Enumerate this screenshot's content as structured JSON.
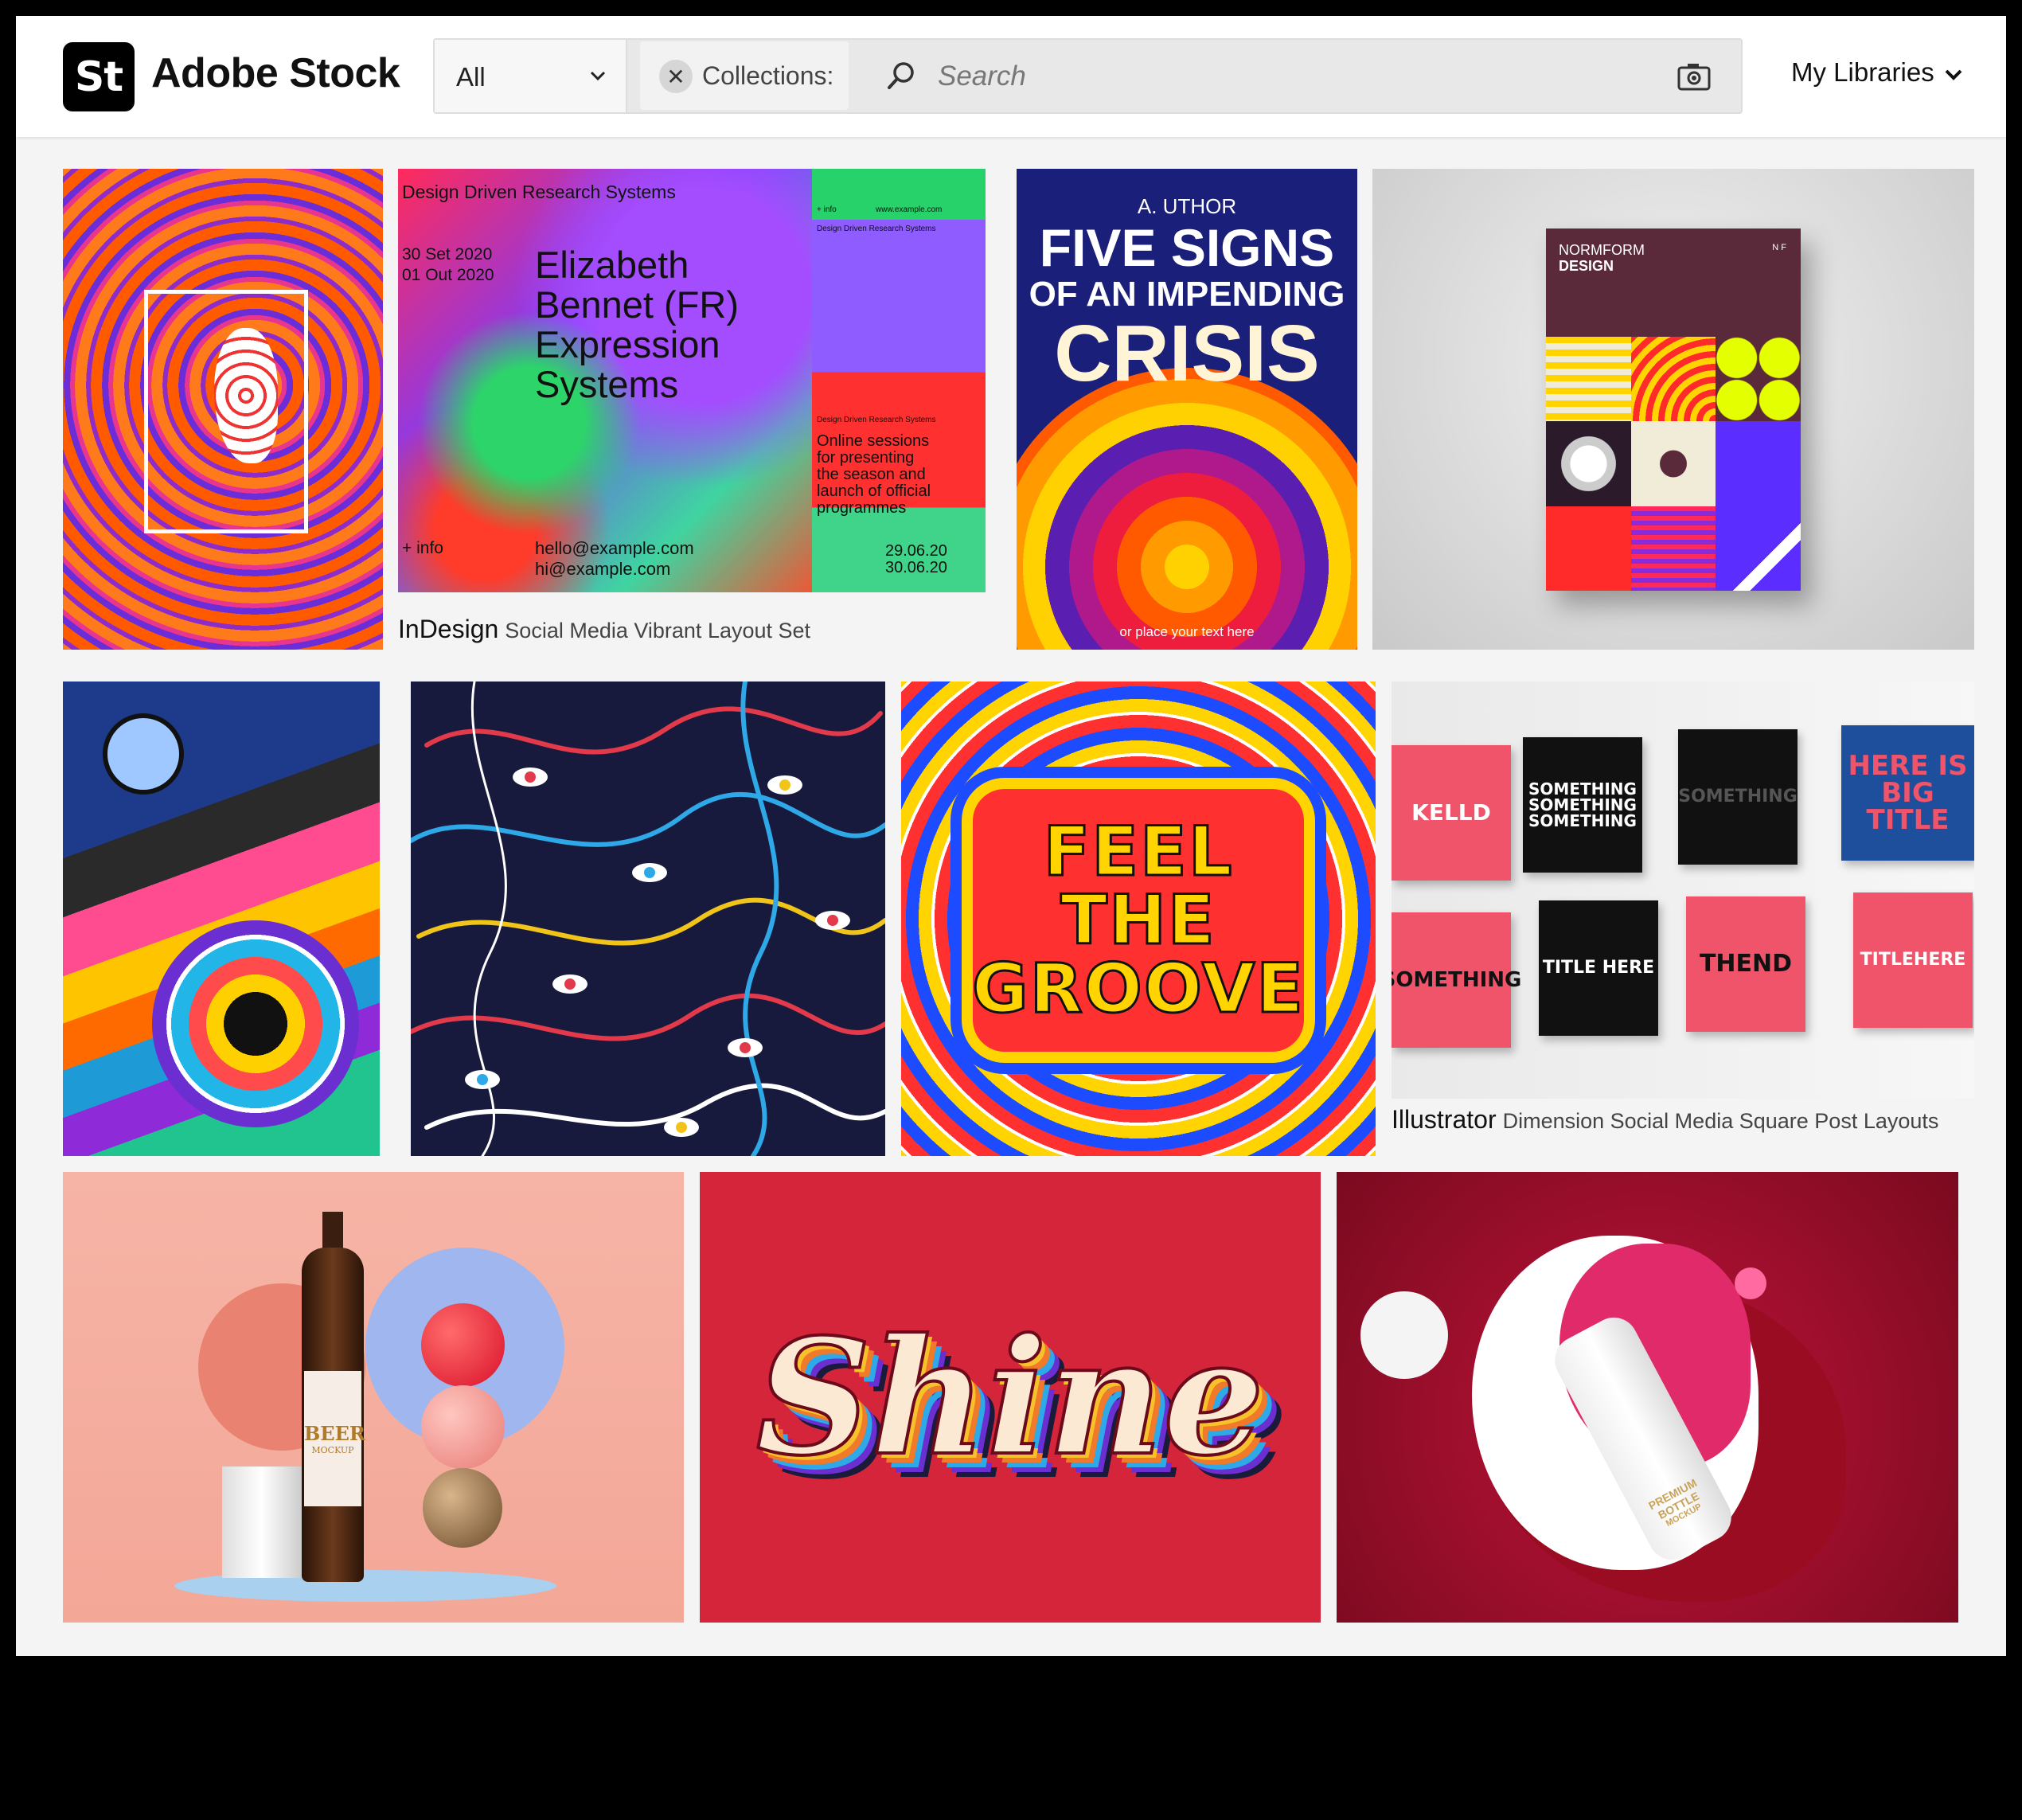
{
  "header": {
    "logo_mark": "St",
    "brand": "Adobe Stock",
    "filter": {
      "selected": "All"
    },
    "collections_chip": "Collections:",
    "search": {
      "placeholder": "Search",
      "value": ""
    },
    "my_libraries": "My Libraries"
  },
  "tiles": {
    "indesign": {
      "title_line": "Design Driven Research Systems",
      "dates": [
        "30 Set 2020",
        "01 Out 2020"
      ],
      "headline": [
        "Elizabeth",
        "Bennet (FR)",
        "Expression",
        "Systems"
      ],
      "info": "+ info",
      "emails": [
        "hello@example.com",
        "hi@example.com"
      ],
      "side_top": "+ info",
      "side_url": "www.example.com",
      "side_title": "Design Driven Research Systems",
      "side_text": [
        "Online sessions",
        "for presenting",
        "the season and",
        "launch of official",
        "programmes"
      ],
      "side_dates": [
        "29.06.20",
        "30.06.20"
      ],
      "caption_app": "InDesign",
      "caption_title": "Social Media Vibrant Layout Set"
    },
    "crisis": {
      "author": "A. UTHOR",
      "line1": "FIVE SIGNS",
      "line2": "OF AN IMPENDING",
      "line3": "CRISIS",
      "footer": "or place your text here"
    },
    "normform": {
      "title": [
        "NORMFORM",
        "DESIGN"
      ],
      "corner": "N F"
    },
    "groove": {
      "lines": [
        "FEEL",
        "THE",
        "GROOVE"
      ]
    },
    "posts": {
      "texts": [
        "KELLD",
        "SOMETHING SOMETHING SOMETHING",
        "SOMETHING",
        "HERE IS BIG TITLE",
        "SOMETHING",
        "TITLE HERE",
        "THEND",
        "TITLEHERE"
      ],
      "caption_app": "Illustrator",
      "caption_title": "Dimension Social Media Square Post Layouts"
    },
    "beer": {
      "label": [
        "BEER",
        "MOCKUP"
      ]
    },
    "shine": {
      "word": "Shine"
    },
    "bottle": {
      "label": [
        "PREMIUM",
        "BOTTLE",
        "MOCKUP"
      ]
    }
  },
  "colors": {
    "brand_black": "#000000",
    "topbar_bg": "#ffffff",
    "page_bg": "#f4f4f4"
  },
  "icons": [
    "chevron-down-icon",
    "close-icon",
    "search-icon",
    "camera-icon"
  ]
}
